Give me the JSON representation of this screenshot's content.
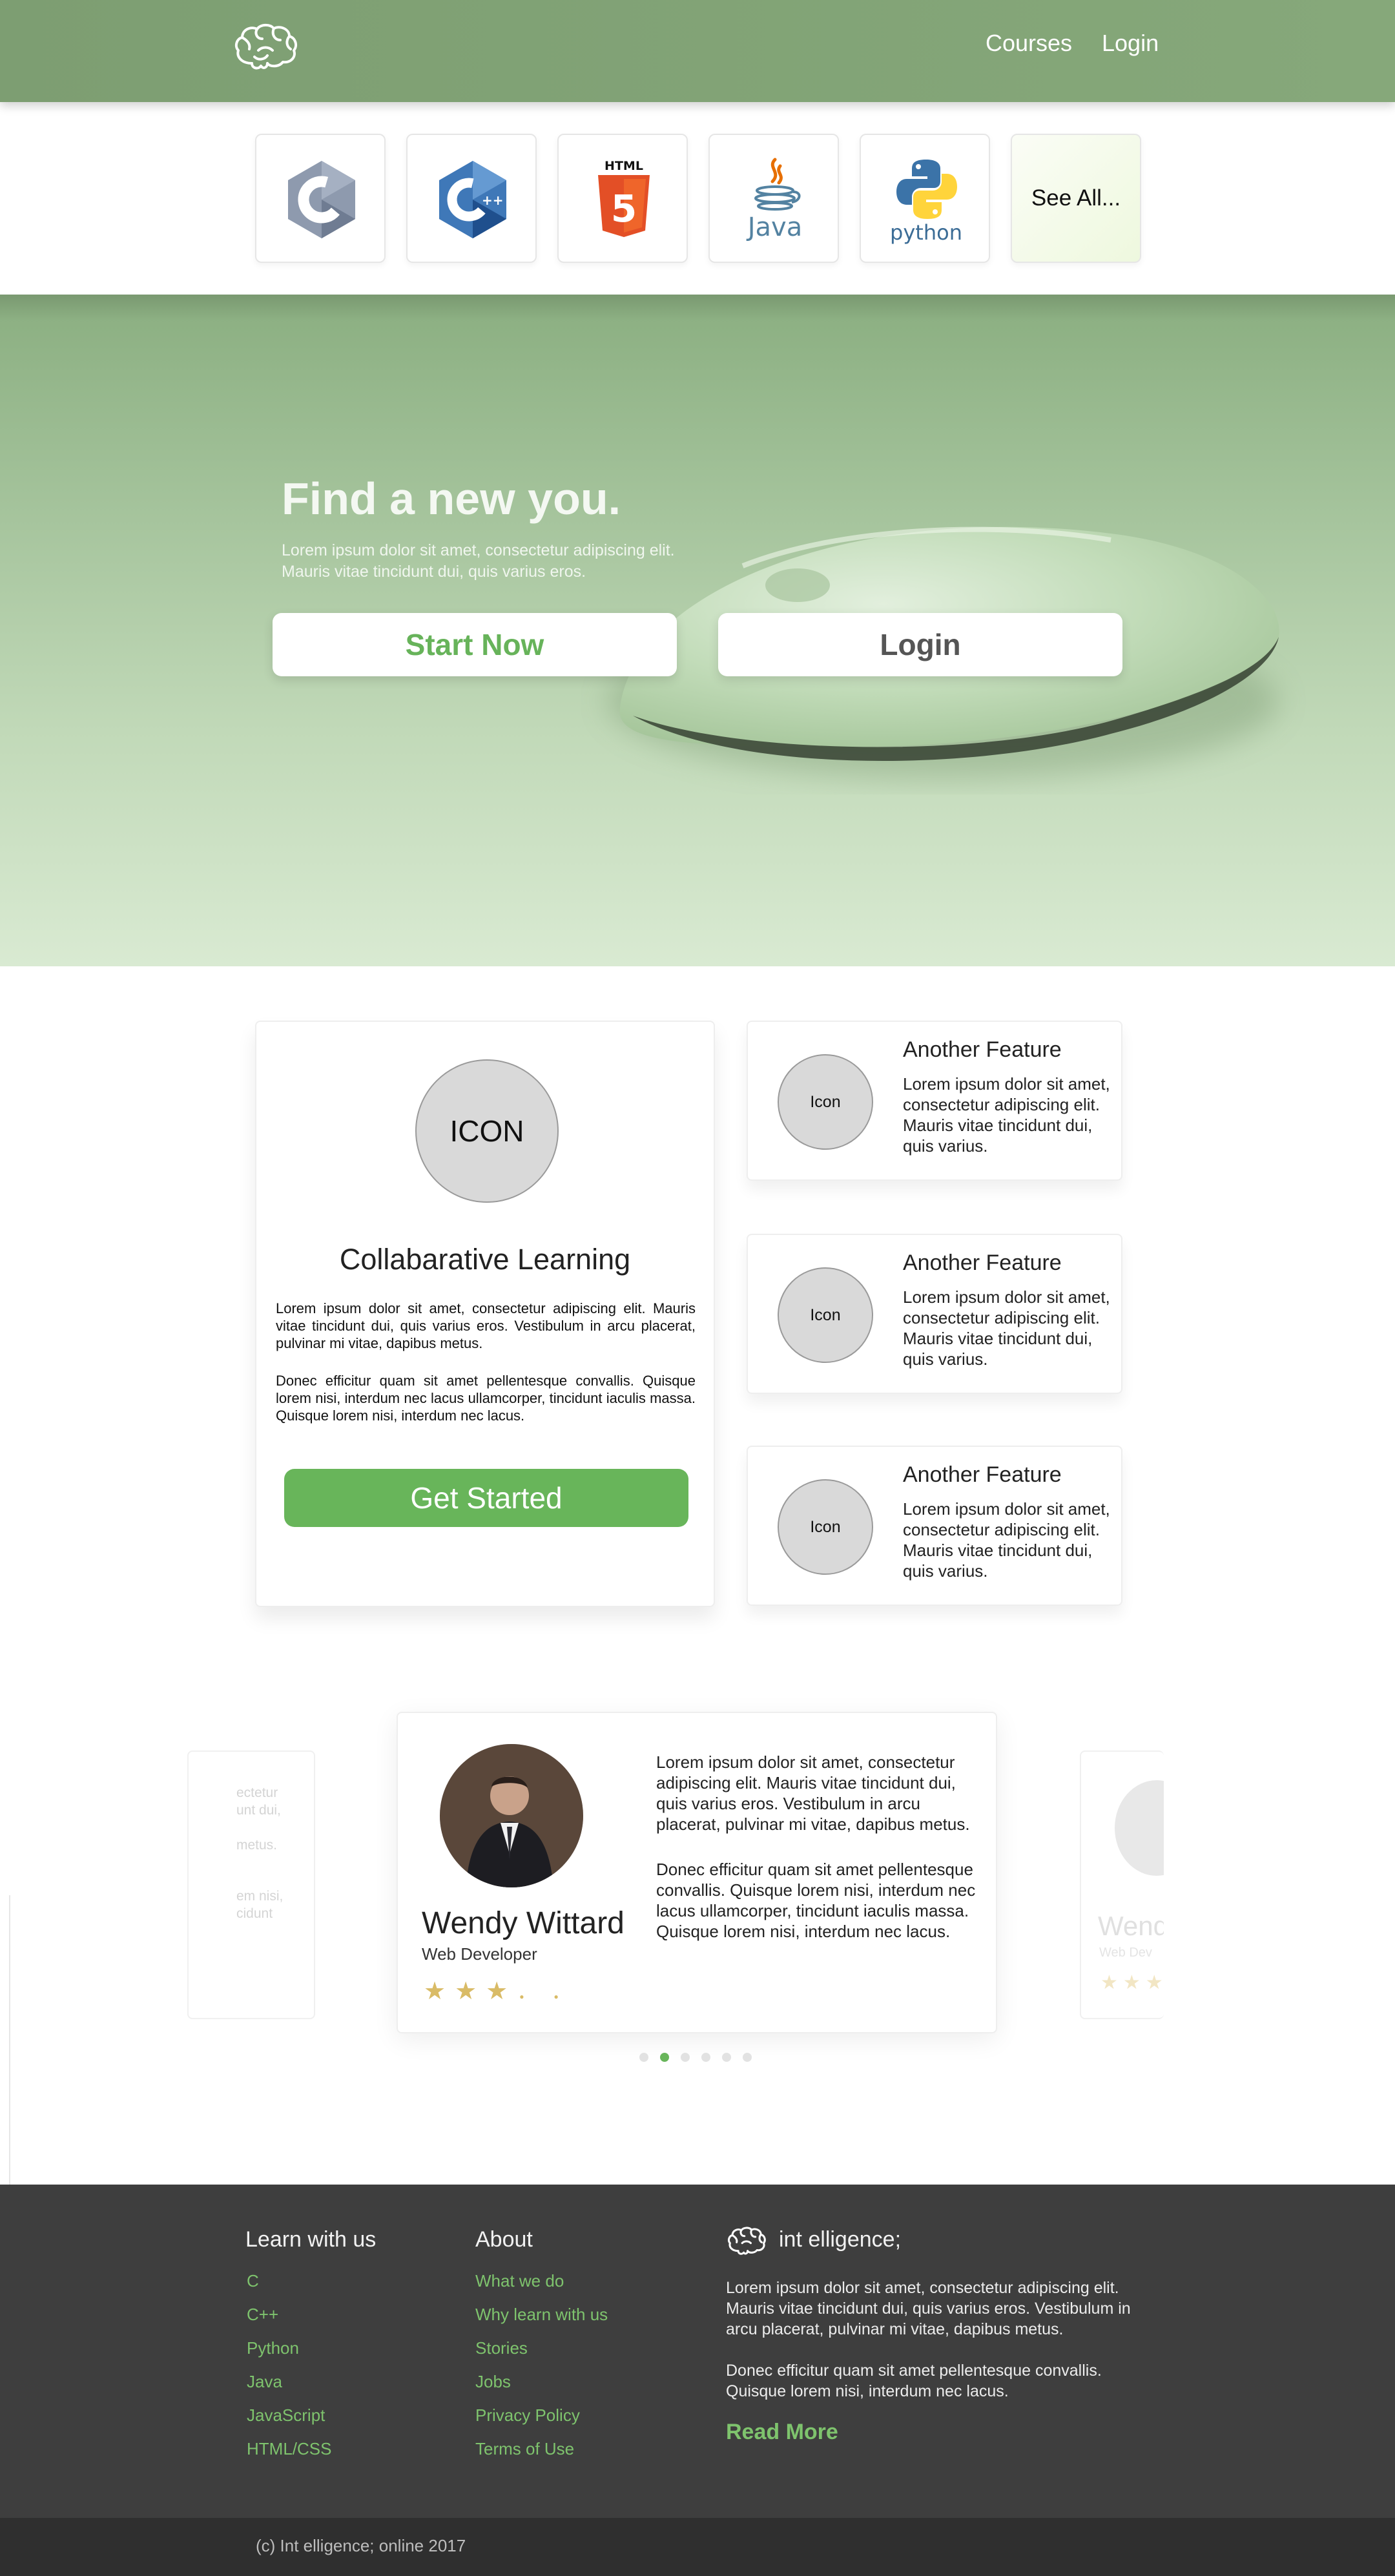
{
  "header": {
    "nav": {
      "courses": "Courses",
      "login": "Login"
    }
  },
  "languages": {
    "items": [
      {
        "name": "C",
        "icon": "c-language-icon"
      },
      {
        "name": "C++",
        "icon": "cpp-language-icon"
      },
      {
        "name": "HTML",
        "icon": "html5-icon"
      },
      {
        "name": "Java",
        "icon": "java-icon"
      },
      {
        "name": "python",
        "icon": "python-icon"
      }
    ],
    "html_label": "HTML",
    "html_number": "5",
    "java_label": "Java",
    "python_label": "python",
    "see_all": "See All..."
  },
  "hero": {
    "title": "Find a new you.",
    "subtitle": "Lorem ipsum dolor sit amet, consectetur adipiscing elit. Mauris vitae tincidunt dui, quis varius eros.",
    "start_button": "Start Now",
    "login_button": "Login"
  },
  "features": {
    "main": {
      "icon_label": "ICON",
      "title": "Collabarative Learning",
      "p1": "Lorem ipsum dolor sit amet, consectetur adipiscing elit. Mauris vitae tincidunt dui, quis varius eros. Vestibulum in arcu placerat, pulvinar mi vitae, dapibus metus.",
      "p2": "Donec efficitur quam sit amet pellentesque convallis. Quisque lorem nisi, interdum nec lacus ullamcorper, tincidunt iaculis massa. Quisque lorem nisi, interdum nec lacus.",
      "button": "Get Started"
    },
    "side": [
      {
        "icon_label": "Icon",
        "title": "Another Feature",
        "text": "Lorem ipsum dolor sit amet, consectetur adipiscing elit. Mauris vitae tincidunt dui, quis varius."
      },
      {
        "icon_label": "Icon",
        "title": "Another Feature",
        "text": "Lorem ipsum dolor sit amet, consectetur adipiscing elit. Mauris vitae tincidunt dui, quis varius."
      },
      {
        "icon_label": "Icon",
        "title": "Another Feature",
        "text": "Lorem ipsum dolor sit amet, consectetur adipiscing elit. Mauris vitae tincidunt dui, quis varius."
      }
    ]
  },
  "testimonials": {
    "active": {
      "name": "Wendy Wittard",
      "role": "Web Developer",
      "rating": 3,
      "rating_max": 5,
      "p1": "Lorem ipsum dolor sit amet, consectetur adipiscing elit. Mauris vitae tincidunt dui, quis varius eros. Vestibulum in arcu placerat, pulvinar mi vitae, dapibus metus.",
      "p2": "Donec efficitur quam sit amet pellentesque convallis. Quisque lorem nisi, interdum nec lacus ullamcorper, tincidunt iaculis massa. Quisque lorem nisi, interdum nec lacus."
    },
    "prev_fragment": {
      "line1": "ectetur\nunt dui,\n \nmetus.",
      "line2": "em nisi,\ncidunt"
    },
    "next_fragment": {
      "name": "Wend",
      "role": "Web Dev"
    },
    "dots": {
      "count": 6,
      "active_index": 1
    }
  },
  "footer": {
    "col1": {
      "heading": "Learn with us",
      "links": [
        "C",
        "C++",
        "Python",
        "Java",
        "JavaScript",
        "HTML/CSS"
      ]
    },
    "col2": {
      "heading": "About",
      "links": [
        "What we do",
        "Why learn with us",
        "Stories",
        "Jobs",
        "Privacy Policy",
        "Terms of Use"
      ]
    },
    "brand": {
      "name": "int elligence;",
      "p1": "Lorem ipsum dolor sit amet, consectetur adipiscing elit. Mauris vitae tincidunt dui, quis varius eros. Vestibulum in arcu placerat, pulvinar mi vitae, dapibus metus.",
      "p2": "Donec efficitur quam sit amet pellentesque convallis. Quisque lorem nisi, interdum nec lacus.",
      "read_more": "Read More"
    },
    "copyright": "(c) Int elligence; online 2017"
  },
  "colors": {
    "header_green": "#86a87a",
    "accent_green": "#68b55a",
    "link_green": "#7ec36d",
    "footer_dark": "#3e3e3e",
    "star_gold": "#d9bb66"
  }
}
